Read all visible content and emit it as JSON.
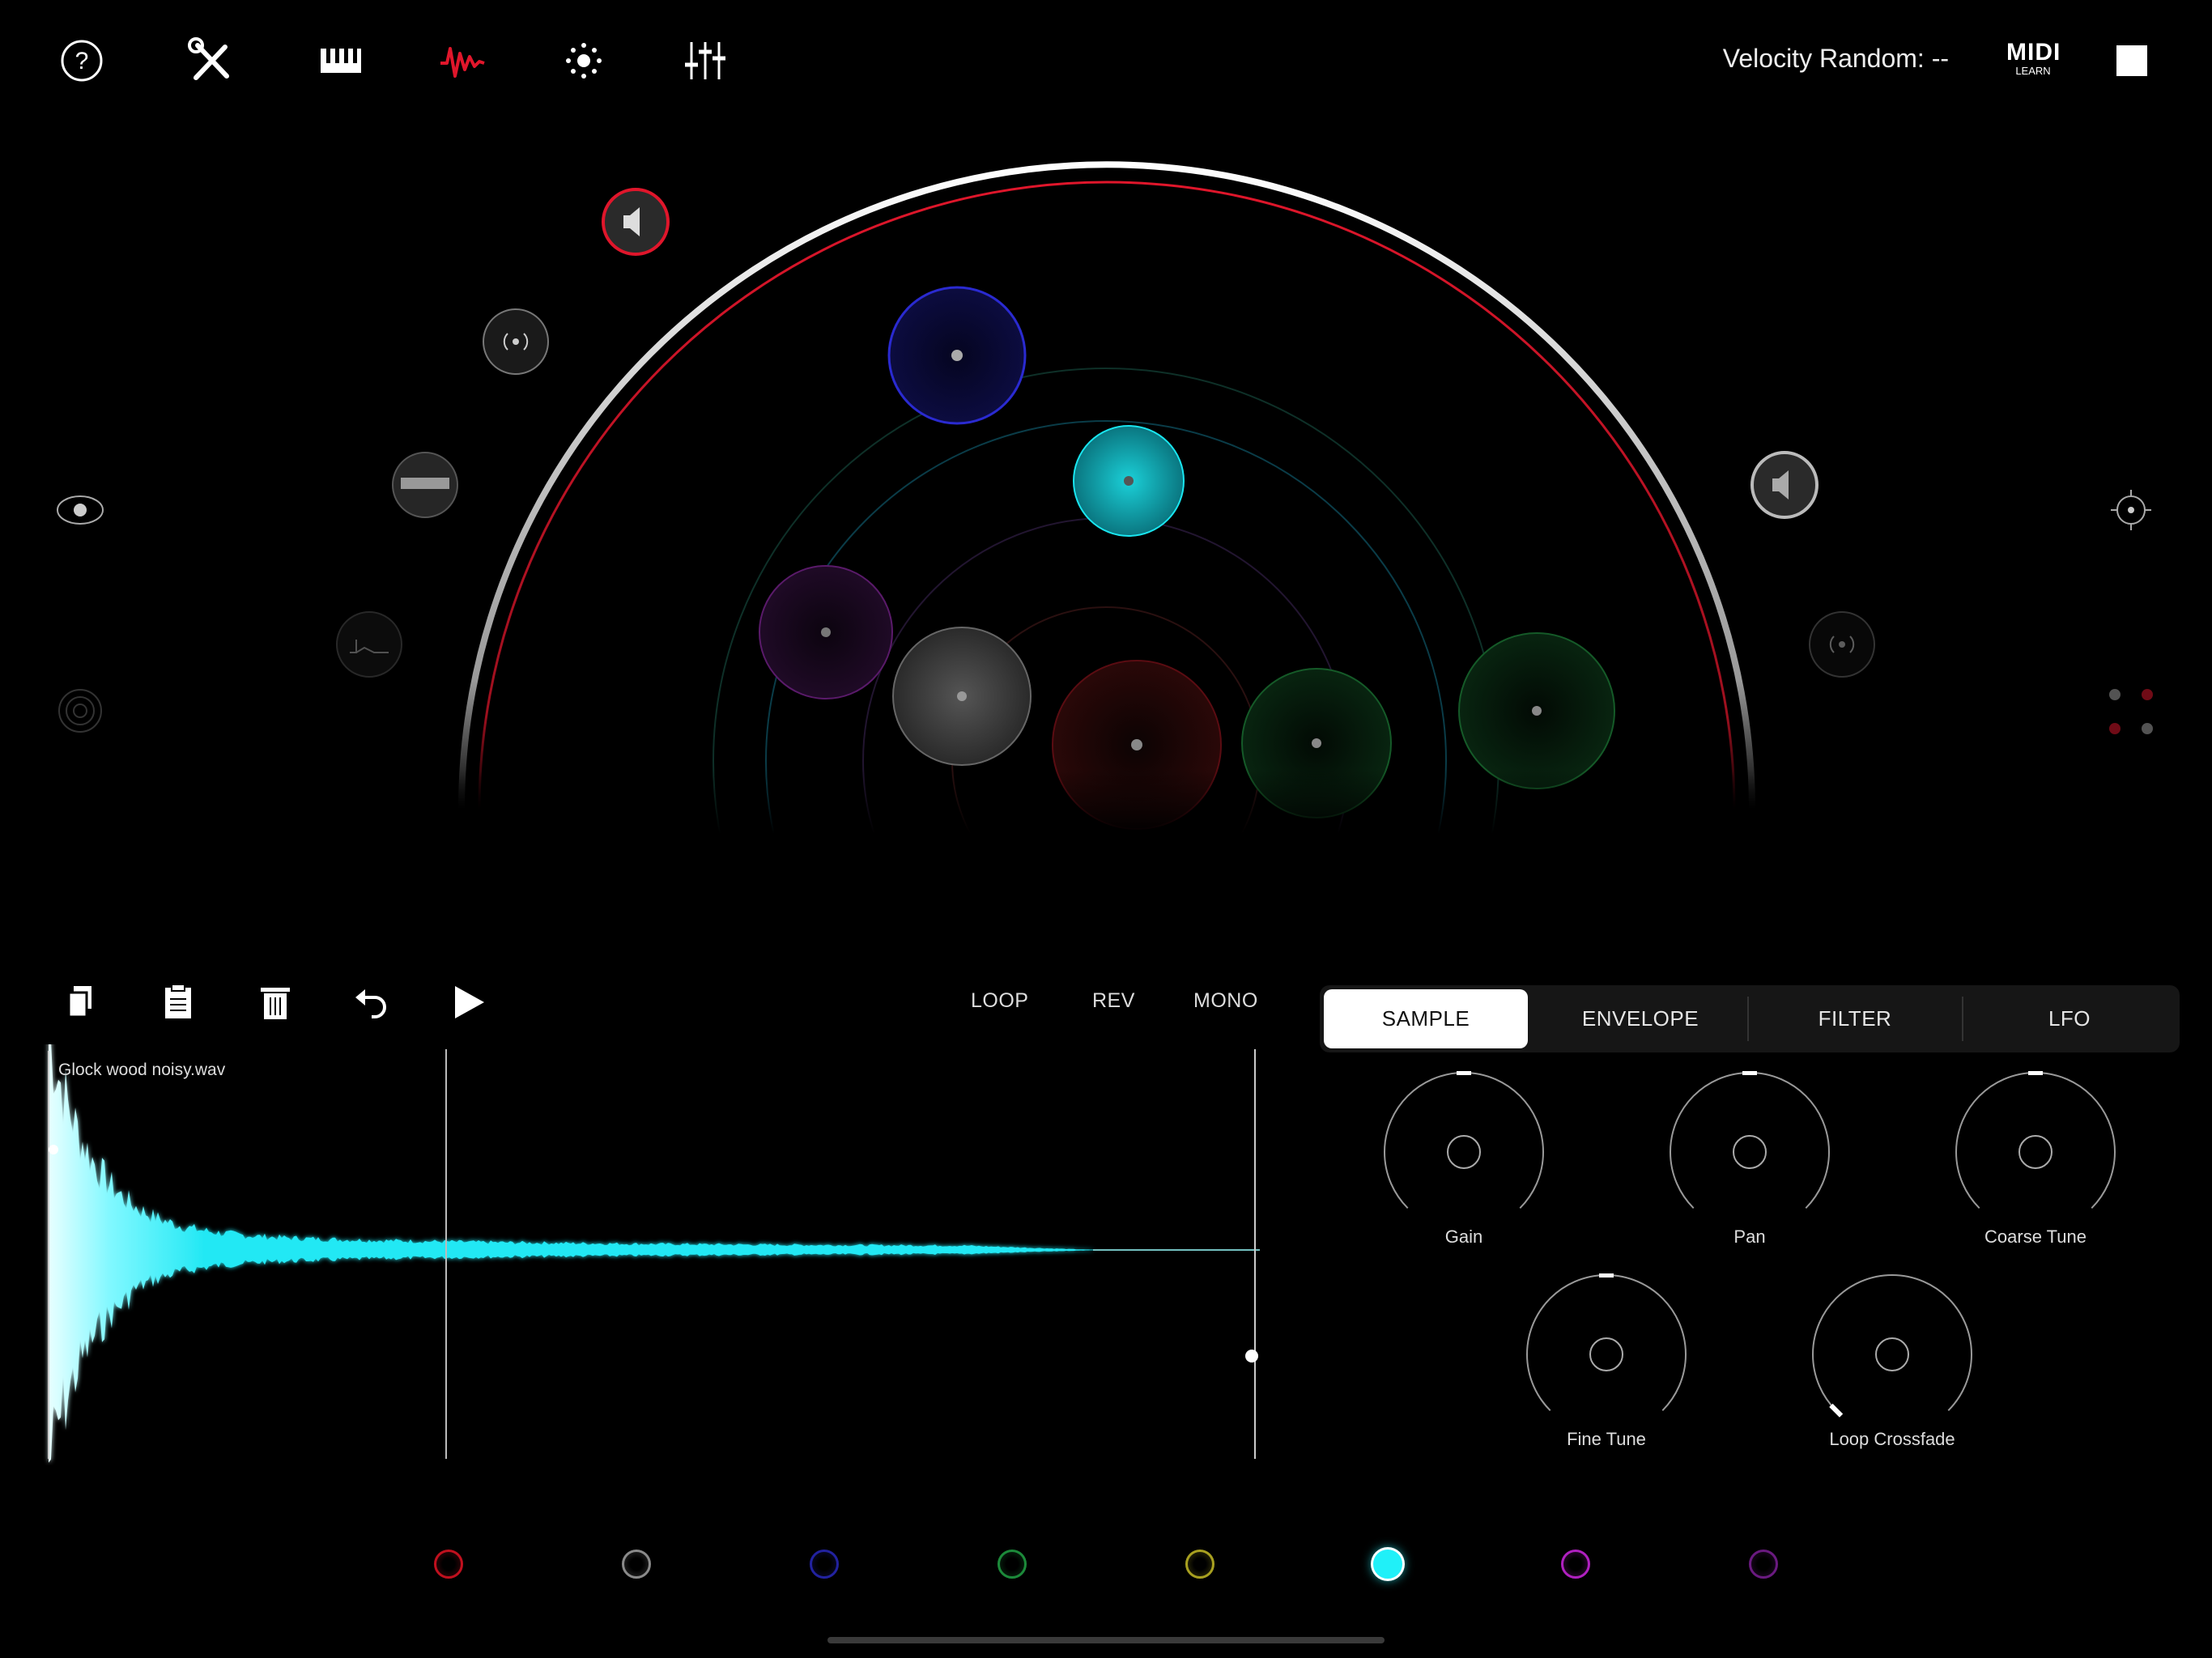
{
  "header": {
    "velocity_label": "Velocity Random: --",
    "midi_learn": {
      "word1": "MIDI",
      "word2": "LEARN"
    },
    "icons": [
      "help-icon",
      "tools-icon",
      "piano-icon",
      "waveform-icon",
      "light-icon",
      "mixer-icon"
    ],
    "active_icon": "waveform-icon",
    "stop_icon": "stop-icon"
  },
  "colors": {
    "accent_red": "#e0162b",
    "cyan": "#19e6f0",
    "blue": "#2a2ad0",
    "green": "#1f8a3a",
    "purple": "#7a1f8a",
    "grey": "#9a9a9a"
  },
  "sample_editor": {
    "toolbar_icons": [
      "copy-icon",
      "paste-icon",
      "delete-icon",
      "undo-icon",
      "play-icon"
    ],
    "modes": [
      "LOOP",
      "REV",
      "MONO"
    ],
    "file_name": "Glock wood noisy.wav"
  },
  "tabs": [
    {
      "label": "SAMPLE",
      "active": true
    },
    {
      "label": "ENVELOPE",
      "active": false
    },
    {
      "label": "FILTER",
      "active": false
    },
    {
      "label": "LFO",
      "active": false
    }
  ],
  "knobs": [
    {
      "label": "Gain",
      "value": 0.5
    },
    {
      "label": "Pan",
      "value": 0.5
    },
    {
      "label": "Coarse Tune",
      "value": 0.5
    },
    {
      "label": "Fine Tune",
      "value": 0.5
    },
    {
      "label": "Loop Crossfade",
      "value": 0
    }
  ],
  "voice_colors": [
    {
      "name": "red",
      "color": "#c0101e",
      "selected": false
    },
    {
      "name": "grey",
      "color": "#8a8a8a",
      "selected": false
    },
    {
      "name": "blue",
      "color": "#2222a0",
      "selected": false
    },
    {
      "name": "green",
      "color": "#1c8a3a",
      "selected": false
    },
    {
      "name": "yellow",
      "color": "#a8a020",
      "selected": false
    },
    {
      "name": "cyan",
      "color": "#20f0f8",
      "selected": true
    },
    {
      "name": "magenta",
      "color": "#b020c0",
      "selected": false
    },
    {
      "name": "purple",
      "color": "#6a1a80",
      "selected": false
    }
  ]
}
